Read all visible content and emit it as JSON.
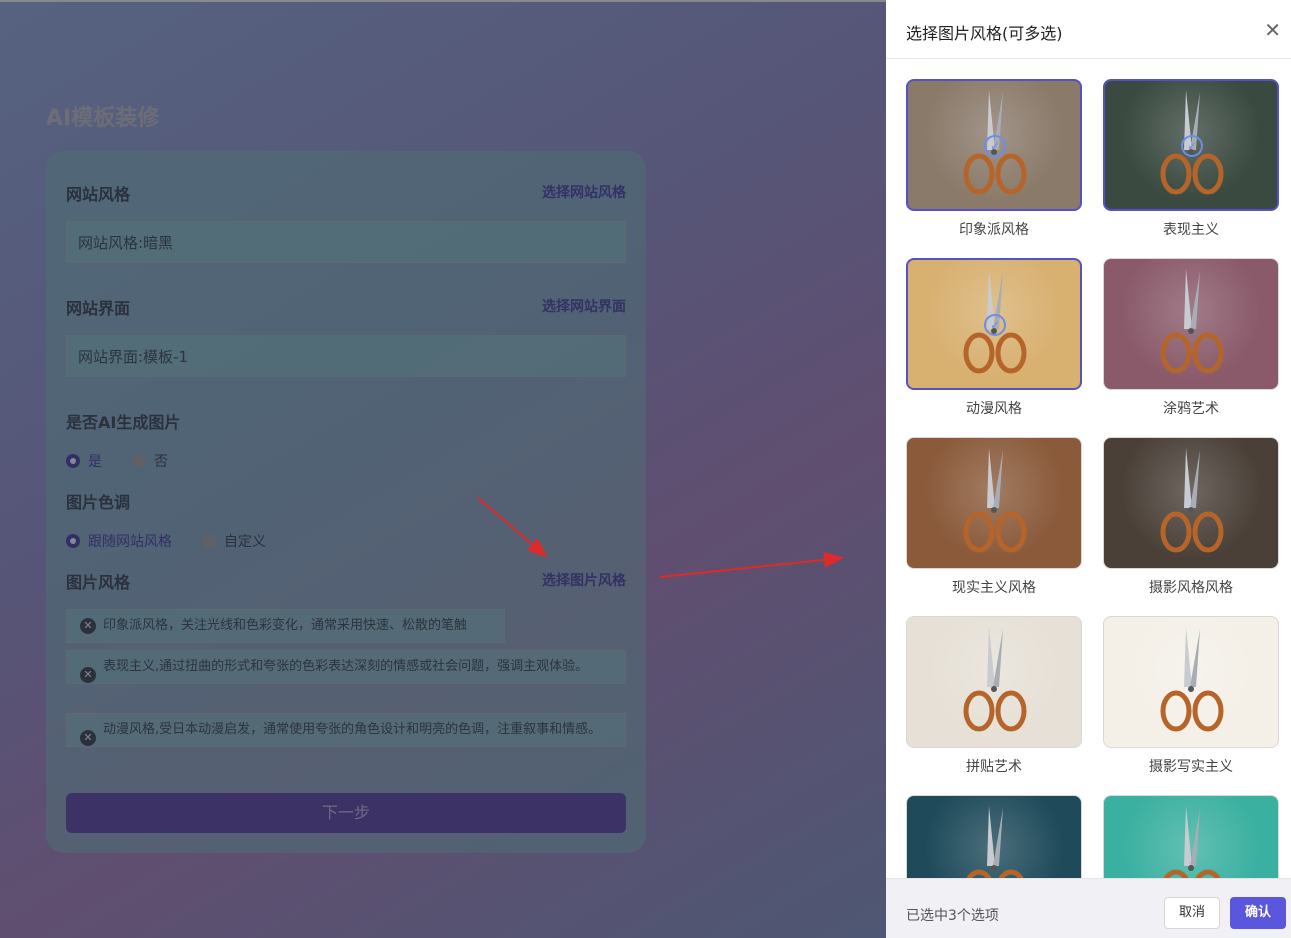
{
  "app": {
    "title": "AI模板装修"
  },
  "form": {
    "site_style": {
      "label": "网站风格",
      "link": "选择网站风格",
      "value": "网站风格:暗黑"
    },
    "site_ui": {
      "label": "网站界面",
      "link": "选择网站界面",
      "value": "网站界面:模板-1"
    },
    "ai_image": {
      "label": "是否AI生成图片",
      "options": [
        "是",
        "否"
      ],
      "selected": "是"
    },
    "color_tone": {
      "label": "图片色调",
      "options": [
        "跟随网站风格",
        "自定义"
      ],
      "selected": "跟随网站风格"
    },
    "image_style": {
      "label": "图片风格",
      "link": "选择图片风格",
      "tags": [
        "印象派风格，关注光线和色彩变化，通常采用快速、松散的笔触",
        "表现主义,通过扭曲的形式和夸张的色彩表达深刻的情感或社会问题，强调主观体验。",
        "动漫风格,受日本动漫启发，通常使用夸张的角色设计和明亮的色调，注重叙事和情感。"
      ]
    },
    "next_button": "下一步"
  },
  "drawer": {
    "title": "选择图片风格(可多选)",
    "close_icon": "close-icon",
    "styles": [
      {
        "name": "印象派风格",
        "selected": true,
        "bg": "#8a7a6a"
      },
      {
        "name": "表现主义",
        "selected": true,
        "bg": "#3a4a40"
      },
      {
        "name": "动漫风格",
        "selected": true,
        "bg": "#d8b070"
      },
      {
        "name": "涂鸦艺术",
        "selected": false,
        "bg": "#8a5a6a"
      },
      {
        "name": "现实主义风格",
        "selected": false,
        "bg": "#8a5a3a"
      },
      {
        "name": "摄影风格风格",
        "selected": false,
        "bg": "#4a4038"
      },
      {
        "name": "拼贴艺术",
        "selected": false,
        "bg": "#e6e0d6"
      },
      {
        "name": "摄影写实主义",
        "selected": false,
        "bg": "#f4f0e8"
      },
      {
        "name": "",
        "selected": false,
        "bg": "#1e4a5a"
      },
      {
        "name": "",
        "selected": false,
        "bg": "#3ab0a0"
      }
    ],
    "footer": {
      "selected_count": "已选中3个选项",
      "cancel": "取消",
      "confirm": "确认"
    }
  },
  "colors": {
    "accent": "#5a57dd",
    "link": "#3d3a8e",
    "arrow": "#e02a2a"
  }
}
